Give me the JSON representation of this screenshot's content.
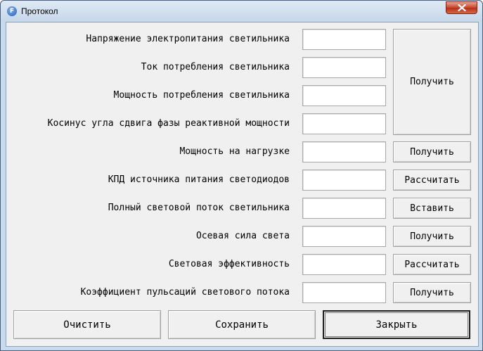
{
  "window": {
    "title": "Протокол",
    "app_icon_letter": "F"
  },
  "rows": [
    {
      "label": "Напряжение электропитания светильника",
      "value": ""
    },
    {
      "label": "Ток потребления светильника",
      "value": ""
    },
    {
      "label": "Мощность потребления светильника",
      "value": ""
    },
    {
      "label": "Косинус угла сдвига фазы реактивной мощности",
      "value": ""
    },
    {
      "label": "Мощность на нагрузке",
      "value": ""
    },
    {
      "label": "КПД источника питания светодиодов",
      "value": ""
    },
    {
      "label": "Полный световой поток светильника",
      "value": ""
    },
    {
      "label": "Осевая сила света",
      "value": ""
    },
    {
      "label": "Световая эффективность",
      "value": ""
    },
    {
      "label": "Коэффициент пульсаций светового потока",
      "value": ""
    }
  ],
  "side_buttons": {
    "group_get": "Получить",
    "power_get": "Получить",
    "efficiency_calc": "Рассчитать",
    "flux_insert": "Вставить",
    "intensity_get": "Получить",
    "efficacy_calc": "Рассчитать",
    "ripple_get": "Получить"
  },
  "bottom_buttons": {
    "clear": "Очистить",
    "save": "Сохранить",
    "close": "Закрыть"
  }
}
